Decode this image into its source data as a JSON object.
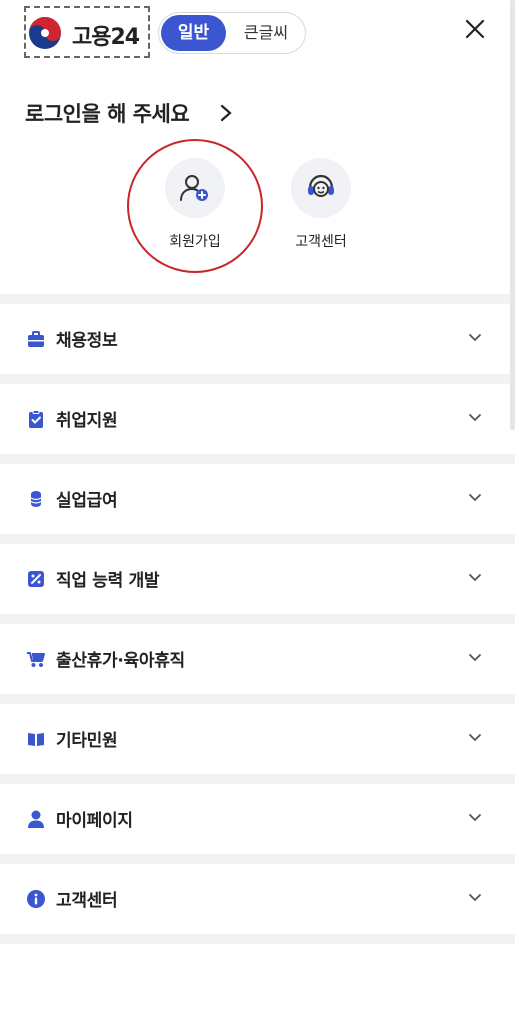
{
  "header": {
    "logo_text": "고용24",
    "font_toggle": {
      "normal": "일반",
      "large": "큰글씨",
      "selected": "일반"
    }
  },
  "login": {
    "label": "로그인을 해 주세요"
  },
  "quick_actions": [
    {
      "label": "회원가입",
      "icon": "user-add-icon"
    },
    {
      "label": "고객센터",
      "icon": "headset-icon"
    }
  ],
  "menu": [
    {
      "label": "채용정보",
      "icon": "briefcase-icon"
    },
    {
      "label": "취업지원",
      "icon": "clipboard-check-icon"
    },
    {
      "label": "실업급여",
      "icon": "coins-icon"
    },
    {
      "label": "직업 능력 개발",
      "icon": "certificate-icon"
    },
    {
      "label": "출산휴가·육아휴직",
      "icon": "stroller-icon"
    },
    {
      "label": "기타민원",
      "icon": "book-icon"
    },
    {
      "label": "마이페이지",
      "icon": "person-icon"
    },
    {
      "label": "고객센터",
      "icon": "info-icon"
    }
  ],
  "colors": {
    "accent": "#3a56d1",
    "highlight_ring": "#c8262b"
  }
}
